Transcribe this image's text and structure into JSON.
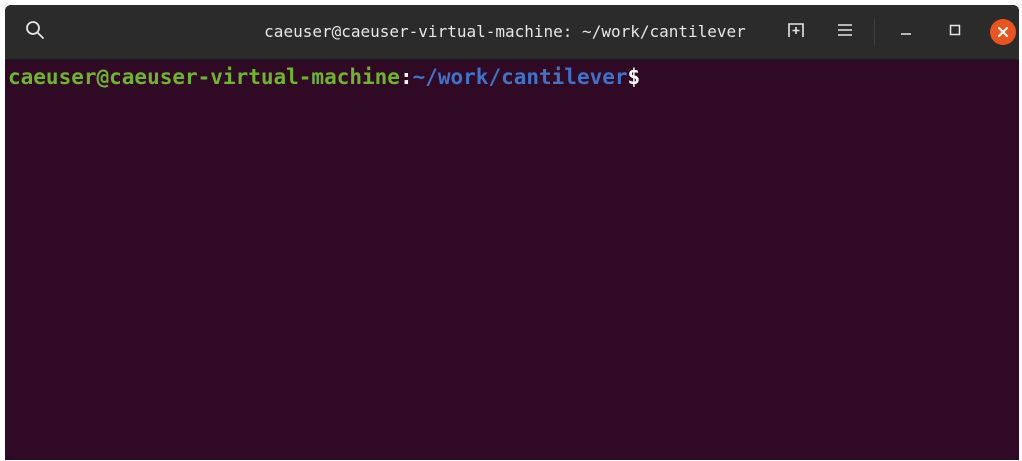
{
  "window": {
    "title": "caeuser@caeuser-virtual-machine: ~/work/cantilever"
  },
  "titlebar": {
    "search_icon": "search-icon",
    "new_tab_icon": "new-tab-icon",
    "menu_icon": "hamburger-menu-icon",
    "minimize_icon": "minimize-icon",
    "maximize_icon": "maximize-icon",
    "close_icon": "close-icon"
  },
  "terminal": {
    "prompt": {
      "user_host": "caeuser@caeuser-virtual-machine",
      "separator": ":",
      "path": "~/work/cantilever",
      "symbol": "$"
    }
  },
  "colors": {
    "terminal_background": "#300a24",
    "titlebar_background": "#2b2b2b",
    "user_host": "#6eb52a",
    "path": "#3f73c8",
    "close_button": "#e95420"
  }
}
